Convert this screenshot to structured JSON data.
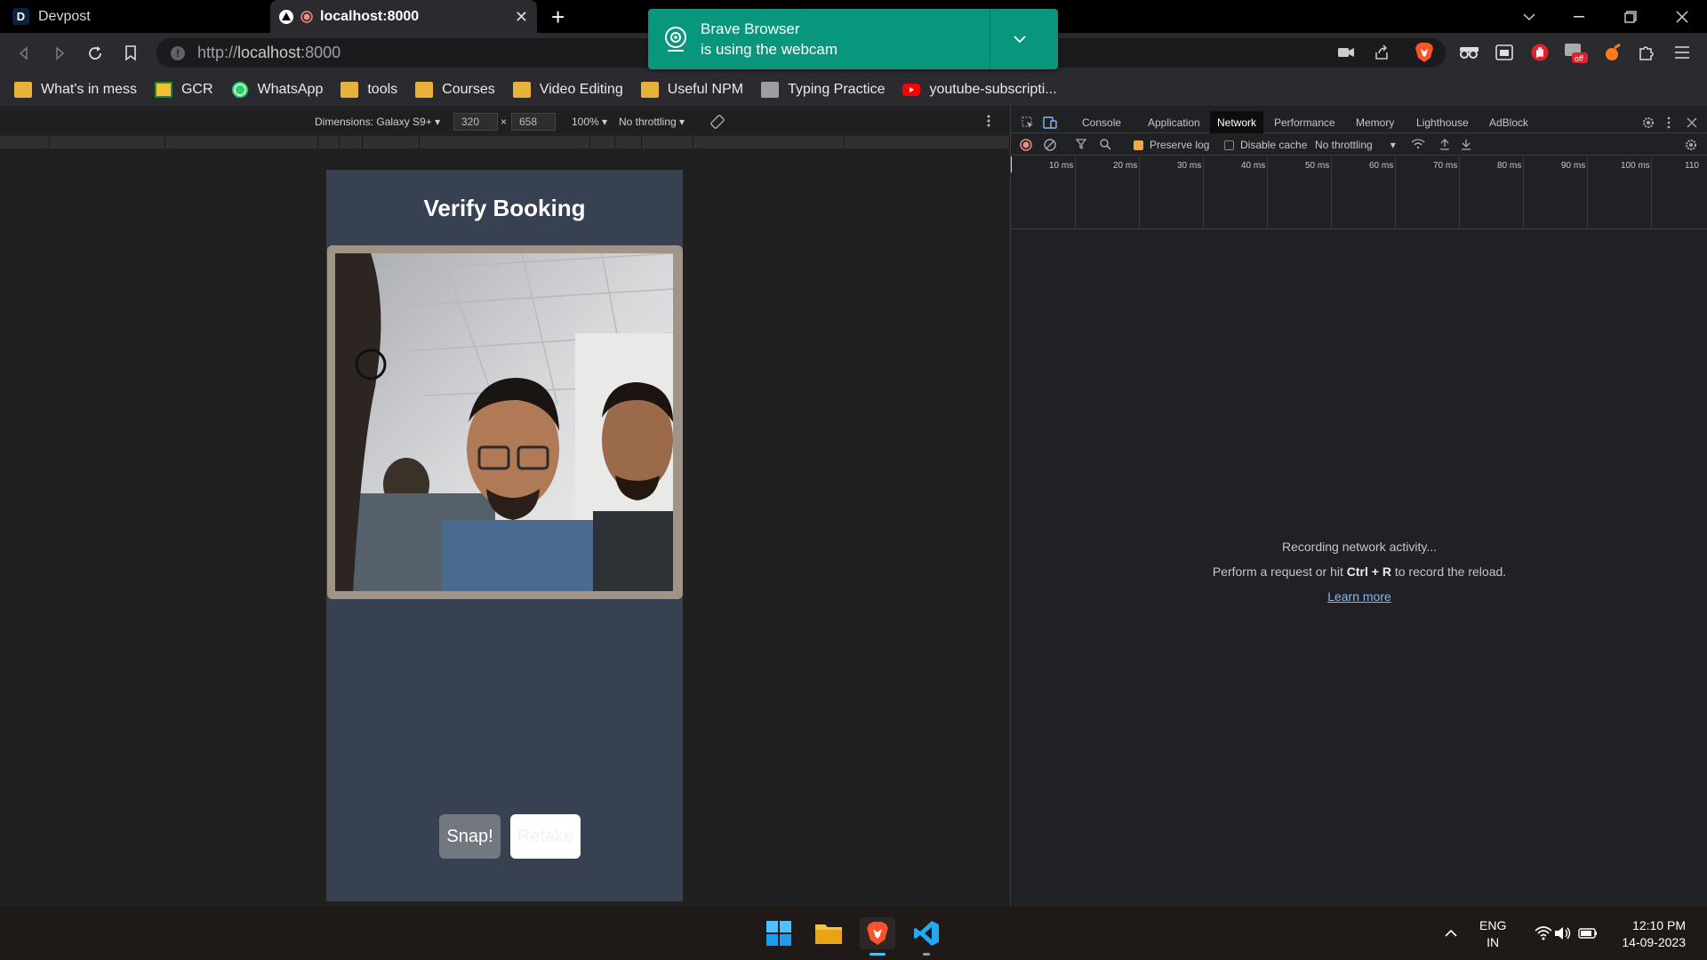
{
  "tabs": [
    {
      "title": "Devpost",
      "favicon": "D"
    },
    {
      "title": "localhost:8000"
    }
  ],
  "address": {
    "scheme": "http://",
    "host": "localhost",
    "port": ":8000"
  },
  "notification": {
    "line1": "Brave Browser",
    "line2": "is using the webcam"
  },
  "bookmarks": [
    {
      "label": "What's in mess",
      "icon": "mess-icon",
      "color": "#e8b23a"
    },
    {
      "label": "GCR",
      "icon": "classroom-icon",
      "color": "#f2c035"
    },
    {
      "label": "WhatsApp",
      "icon": "whatsapp-icon",
      "color": "#25d366"
    },
    {
      "label": "tools",
      "icon": "folder-icon",
      "color": "#e8b23a"
    },
    {
      "label": "Courses",
      "icon": "folder-icon",
      "color": "#e8b23a"
    },
    {
      "label": "Video Editing",
      "icon": "folder-icon",
      "color": "#e8b23a"
    },
    {
      "label": "Useful NPM",
      "icon": "folder-icon",
      "color": "#e8b23a"
    },
    {
      "label": "Typing Practice",
      "icon": "typing-icon",
      "color": "#9e9e9e"
    },
    {
      "label": "youtube-subscripti...",
      "icon": "youtube-icon",
      "color": "#ff0000"
    }
  ],
  "device_toolbar": {
    "dimensions": "Dimensions: Galaxy S9+",
    "width": "320",
    "x": "×",
    "height": "658",
    "zoom": "100%",
    "throttling": "No throttling"
  },
  "page": {
    "title": "Verify Booking",
    "snap": "Snap!",
    "retake": "Retake"
  },
  "devtools": {
    "tabs": [
      "Console",
      "Application",
      "Network",
      "Performance",
      "Memory",
      "Lighthouse",
      "AdBlock"
    ],
    "active_tab": "Network",
    "preserve_log": "Preserve log",
    "disable_cache": "Disable cache",
    "throttling": "No throttling",
    "timeline": [
      "10 ms",
      "20 ms",
      "30 ms",
      "40 ms",
      "50 ms",
      "60 ms",
      "70 ms",
      "80 ms",
      "90 ms",
      "100 ms",
      "110"
    ],
    "msg1": "Recording network activity...",
    "msg2_pre": "Perform a request or hit ",
    "msg2_key": "Ctrl + R",
    "msg2_post": " to record the reload.",
    "learn_more": "Learn more"
  },
  "taskbar": {
    "lang1": "ENG",
    "lang2": "IN",
    "time": "12:10 PM",
    "date": "14-09-2023"
  },
  "colors": {
    "accent": "#08967c",
    "page_bg": "#374151",
    "preserve_checkbox": "#f3a73f"
  }
}
